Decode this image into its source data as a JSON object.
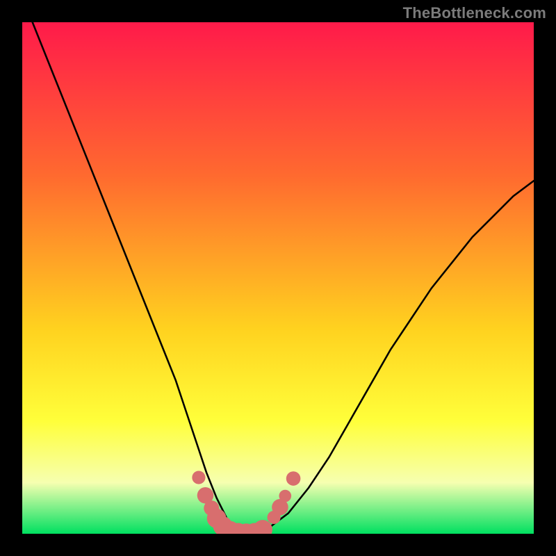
{
  "watermark": "TheBottleneck.com",
  "colors": {
    "frame": "#000000",
    "grad_top": "#ff1a4a",
    "grad_mid1": "#ff6a2f",
    "grad_mid2": "#ffd21f",
    "grad_low": "#ffff3a",
    "grad_pale": "#f6ffb0",
    "grad_green": "#00e060",
    "curve": "#000000",
    "markers": "#d86e6e"
  },
  "chart_data": {
    "type": "line",
    "title": "",
    "xlabel": "",
    "ylabel": "",
    "xlim": [
      0,
      100
    ],
    "ylim": [
      0,
      100
    ],
    "grid": false,
    "legend": false,
    "gradient_stops": [
      {
        "pos": 0.0,
        "color": "#ff1a4a"
      },
      {
        "pos": 0.3,
        "color": "#ff6a2f"
      },
      {
        "pos": 0.6,
        "color": "#ffd21f"
      },
      {
        "pos": 0.78,
        "color": "#ffff3a"
      },
      {
        "pos": 0.9,
        "color": "#f6ffb0"
      },
      {
        "pos": 1.0,
        "color": "#00e060"
      }
    ],
    "series": [
      {
        "name": "bottleneck-curve",
        "x": [
          2,
          6,
          10,
          14,
          18,
          22,
          26,
          30,
          32,
          34,
          36,
          38,
          40,
          42,
          44,
          46,
          48,
          52,
          56,
          60,
          64,
          68,
          72,
          76,
          80,
          84,
          88,
          92,
          96,
          100
        ],
        "y": [
          100,
          90,
          80,
          70,
          60,
          50,
          40,
          30,
          24,
          18,
          12,
          7,
          3,
          1,
          0,
          0,
          1,
          4,
          9,
          15,
          22,
          29,
          36,
          42,
          48,
          53,
          58,
          62,
          66,
          69
        ]
      }
    ],
    "markers": [
      {
        "x": 34.5,
        "y": 11.0,
        "r": 1.3
      },
      {
        "x": 35.8,
        "y": 7.5,
        "r": 1.6
      },
      {
        "x": 37.0,
        "y": 5.0,
        "r": 1.5
      },
      {
        "x": 38.0,
        "y": 3.0,
        "r": 1.9
      },
      {
        "x": 39.2,
        "y": 1.5,
        "r": 1.9
      },
      {
        "x": 40.6,
        "y": 0.6,
        "r": 1.9
      },
      {
        "x": 42.2,
        "y": 0.2,
        "r": 1.9
      },
      {
        "x": 43.8,
        "y": 0.1,
        "r": 1.9
      },
      {
        "x": 45.4,
        "y": 0.2,
        "r": 1.9
      },
      {
        "x": 47.0,
        "y": 0.8,
        "r": 1.9
      },
      {
        "x": 49.2,
        "y": 3.2,
        "r": 1.3
      },
      {
        "x": 50.4,
        "y": 5.2,
        "r": 1.6
      },
      {
        "x": 51.4,
        "y": 7.4,
        "r": 1.2
      },
      {
        "x": 53.0,
        "y": 10.8,
        "r": 1.4
      }
    ]
  }
}
